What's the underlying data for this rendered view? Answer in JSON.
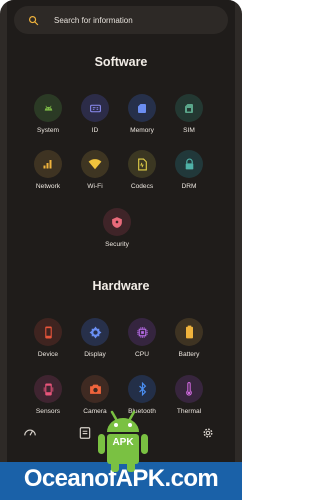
{
  "search": {
    "placeholder": "Search for information"
  },
  "software": {
    "title": "Software",
    "items": [
      {
        "label": "System",
        "icon": "android-icon",
        "color": "#7dba47",
        "bg": "#2b3a25"
      },
      {
        "label": "ID",
        "icon": "id-card-icon",
        "color": "#8b8cf2",
        "bg": "#2c2c48"
      },
      {
        "label": "Memory",
        "icon": "sd-card-icon",
        "color": "#6b8ef2",
        "bg": "#26304a"
      },
      {
        "label": "SIM",
        "icon": "sim-card-icon",
        "color": "#5aa58a",
        "bg": "#233832"
      },
      {
        "label": "Network",
        "icon": "signal-icon",
        "color": "#f0b33c",
        "bg": "#3e3322"
      },
      {
        "label": "Wi-Fi",
        "icon": "wifi-icon",
        "color": "#f0c33c",
        "bg": "#3e3522"
      },
      {
        "label": "Codecs",
        "icon": "file-icon",
        "color": "#e6d34a",
        "bg": "#3b3722"
      },
      {
        "label": "DRM",
        "icon": "lock-icon",
        "color": "#4fb2a8",
        "bg": "#21383a"
      },
      {
        "label": "Security",
        "icon": "shield-icon",
        "color": "#e86a7a",
        "bg": "#3f2428"
      }
    ]
  },
  "hardware": {
    "title": "Hardware",
    "items": [
      {
        "label": "Device",
        "icon": "phone-icon",
        "color": "#e8553a",
        "bg": "#3f2420"
      },
      {
        "label": "Display",
        "icon": "brightness-icon",
        "color": "#6a8ff2",
        "bg": "#27304a"
      },
      {
        "label": "CPU",
        "icon": "chip-icon",
        "color": "#b86ae8",
        "bg": "#35253f"
      },
      {
        "label": "Battery",
        "icon": "battery-icon",
        "color": "#f0b33c",
        "bg": "#3e3322"
      },
      {
        "label": "Sensors",
        "icon": "sensor-icon",
        "color": "#e8557a",
        "bg": "#3f2430"
      },
      {
        "label": "Camera",
        "icon": "camera-icon",
        "color": "#f0643c",
        "bg": "#3f2a22"
      },
      {
        "label": "Bluetooth",
        "icon": "bluetooth-icon",
        "color": "#4a8ef2",
        "bg": "#232f48"
      },
      {
        "label": "Thermal",
        "icon": "thermometer-icon",
        "color": "#d26ae0",
        "bg": "#37253d"
      }
    ]
  },
  "watermark": {
    "text": "OceanofAPK.com",
    "badge": "APK"
  },
  "colors": {
    "accent": "#f0b33c",
    "background": "#1f1c1a"
  }
}
